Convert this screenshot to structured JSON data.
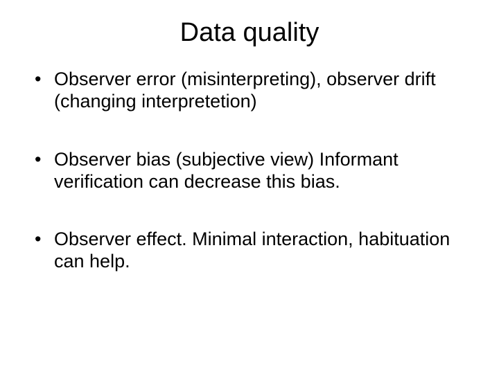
{
  "title": "Data quality",
  "bullets": [
    "Observer error (misinterpreting), observer drift (changing interpretetion)",
    "Observer bias (subjective view) Informant verification can decrease this bias.",
    "Observer effect.\nMinimal interaction, habituation can help."
  ]
}
